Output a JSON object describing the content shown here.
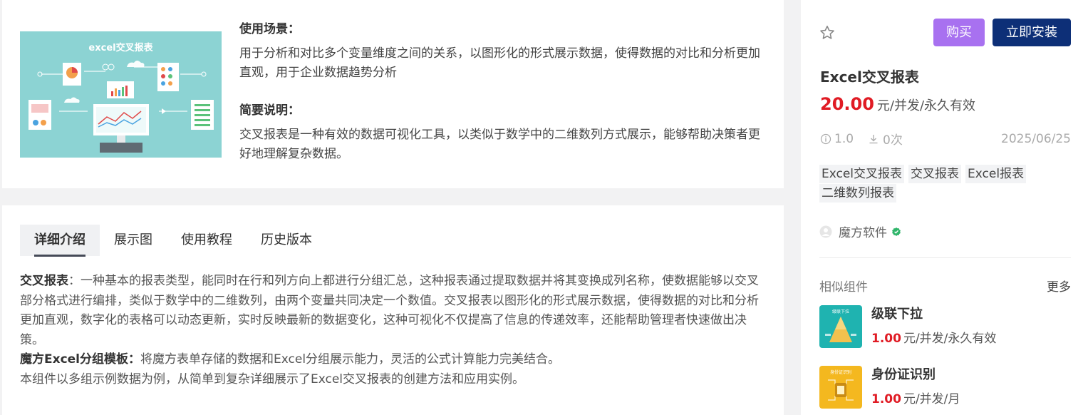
{
  "product": {
    "thumbnail_title": "excel交叉报表",
    "scene_title": "使用场景：",
    "scene_text": "用于分析和对比多个变量维度之间的关系，以图形化的形式展示数据，使得数据的对比和分析更加直观，用于企业数据趋势分析",
    "brief_title": "简要说明：",
    "brief_text": "交叉报表是一种有效的数据可视化工具，以类似于数学中的二维数列方式展示，能够帮助决策者更好地理解复杂数据。"
  },
  "tabs": [
    {
      "label": "详细介绍"
    },
    {
      "label": "展示图"
    },
    {
      "label": "使用教程"
    },
    {
      "label": "历史版本"
    }
  ],
  "detail": {
    "p1_bold": "交叉报表",
    "p1_text": "：一种基本的报表类型，能同时在行和列方向上都进行分组汇总，这种报表通过提取数据并将其变换成列名称，使数据能够以交叉部分格式进行编排，类似于数学中的二维数列，由两个变量共同决定一个数值。交叉报表以图形化的形式展示数据，使得数据的对比和分析更加直观，数字化的表格可以动态更新，实时反映最新的数据变化，这种可视化不仅提高了信息的传递效率，还能帮助管理者快速做出决策。",
    "p2_bold": "魔方Excel分组模板：",
    "p2_text": "将魔方表单存储的数据和Excel分组展示能力，灵活的公式计算能力完美结合。",
    "p3_text": "本组件以多组示例数据为例，从简单到复杂详细展示了Excel交叉报表的创建方法和应用实例。"
  },
  "side": {
    "buy_label": "购买",
    "install_label": "立即安装",
    "title": "Excel交叉报表",
    "price": "20.00",
    "price_unit": "元/并发/永久有效",
    "version": "1.0",
    "downloads": "0次",
    "date": "2025/06/25",
    "tags": [
      "Excel交叉报表",
      "交叉报表",
      "Excel报表",
      "二维数列报表"
    ],
    "author": "魔方软件",
    "similar_title": "相似组件",
    "more_label": "更多",
    "similar": [
      {
        "name": "级联下拉",
        "price": "1.00",
        "unit": "元/并发/永久有效",
        "thumb_label": "级联下拉"
      },
      {
        "name": "身份证识别",
        "price": "1.00",
        "unit": "元/并发/月",
        "thumb_label": "身份证识别"
      }
    ]
  },
  "colors": {
    "accent_purple": "#a871f0",
    "accent_navy": "#0d2f77",
    "price_red": "#e01b24",
    "thumb_teal": "#8cd3d3"
  }
}
